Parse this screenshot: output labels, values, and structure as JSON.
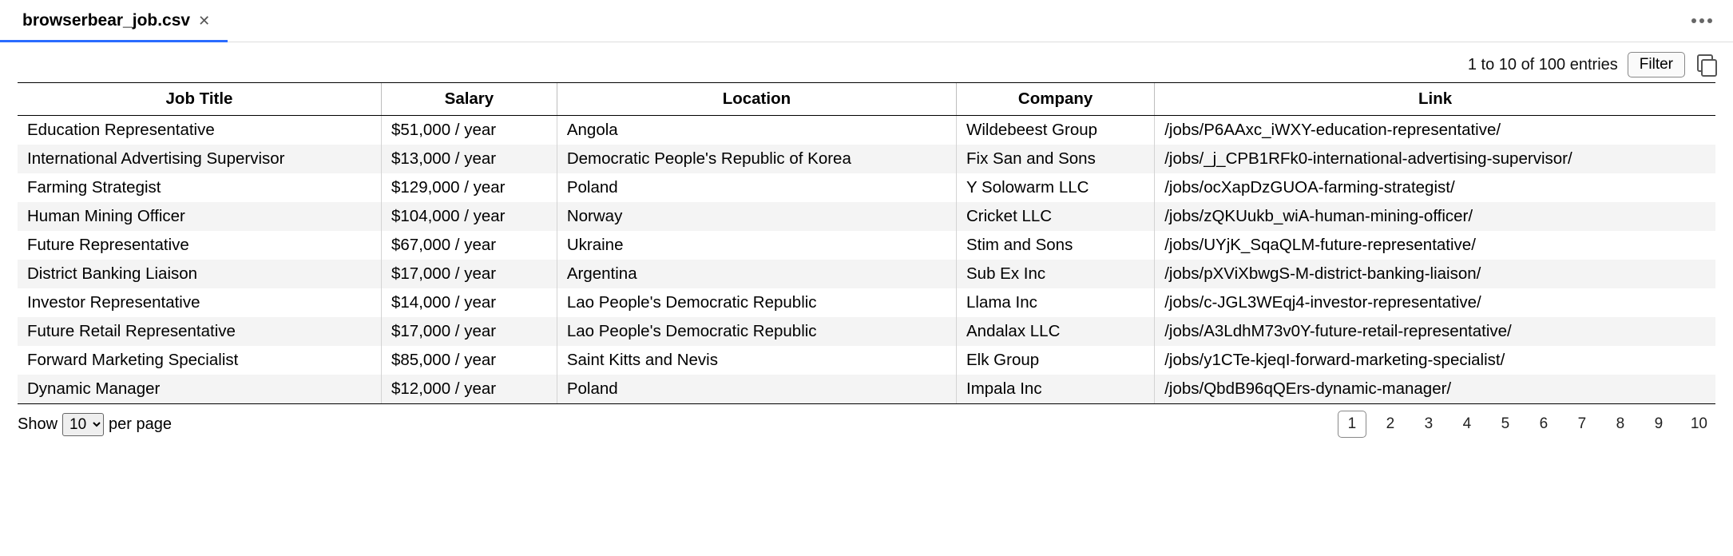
{
  "tab": {
    "title": "browserbear_job.csv"
  },
  "toolbar": {
    "status": "1 to 10 of 100 entries",
    "filter_label": "Filter"
  },
  "table": {
    "headers": [
      "Job Title",
      "Salary",
      "Location",
      "Company",
      "Link"
    ],
    "rows": [
      {
        "title": "Education Representative",
        "salary": "$51,000 / year",
        "location": "Angola",
        "company": "Wildebeest Group",
        "link": "/jobs/P6AAxc_iWXY-education-representative/"
      },
      {
        "title": "International Advertising Supervisor",
        "salary": "$13,000 / year",
        "location": "Democratic People's Republic of Korea",
        "company": "Fix San and Sons",
        "link": "/jobs/_j_CPB1RFk0-international-advertising-supervisor/"
      },
      {
        "title": "Farming Strategist",
        "salary": "$129,000 / year",
        "location": "Poland",
        "company": "Y Solowarm LLC",
        "link": "/jobs/ocXapDzGUOA-farming-strategist/"
      },
      {
        "title": "Human Mining Officer",
        "salary": "$104,000 / year",
        "location": "Norway",
        "company": "Cricket LLC",
        "link": "/jobs/zQKUukb_wiA-human-mining-officer/"
      },
      {
        "title": "Future Representative",
        "salary": "$67,000 / year",
        "location": "Ukraine",
        "company": "Stim and Sons",
        "link": "/jobs/UYjK_SqaQLM-future-representative/"
      },
      {
        "title": "District Banking Liaison",
        "salary": "$17,000 / year",
        "location": "Argentina",
        "company": "Sub Ex Inc",
        "link": "/jobs/pXViXbwgS-M-district-banking-liaison/"
      },
      {
        "title": "Investor Representative",
        "salary": "$14,000 / year",
        "location": "Lao People's Democratic Republic",
        "company": "Llama Inc",
        "link": "/jobs/c-JGL3WEqj4-investor-representative/"
      },
      {
        "title": "Future Retail Representative",
        "salary": "$17,000 / year",
        "location": "Lao People's Democratic Republic",
        "company": "Andalax LLC",
        "link": "/jobs/A3LdhM73v0Y-future-retail-representative/"
      },
      {
        "title": "Forward Marketing Specialist",
        "salary": "$85,000 / year",
        "location": "Saint Kitts and Nevis",
        "company": "Elk Group",
        "link": "/jobs/y1CTe-kjeqI-forward-marketing-specialist/"
      },
      {
        "title": "Dynamic Manager",
        "salary": "$12,000 / year",
        "location": "Poland",
        "company": "Impala Inc",
        "link": "/jobs/QbdB96qQErs-dynamic-manager/"
      }
    ]
  },
  "footer": {
    "show_label": "Show",
    "per_page_label": "per page",
    "page_size": "10",
    "pages": [
      "1",
      "2",
      "3",
      "4",
      "5",
      "6",
      "7",
      "8",
      "9",
      "10"
    ],
    "active_page": "1"
  }
}
